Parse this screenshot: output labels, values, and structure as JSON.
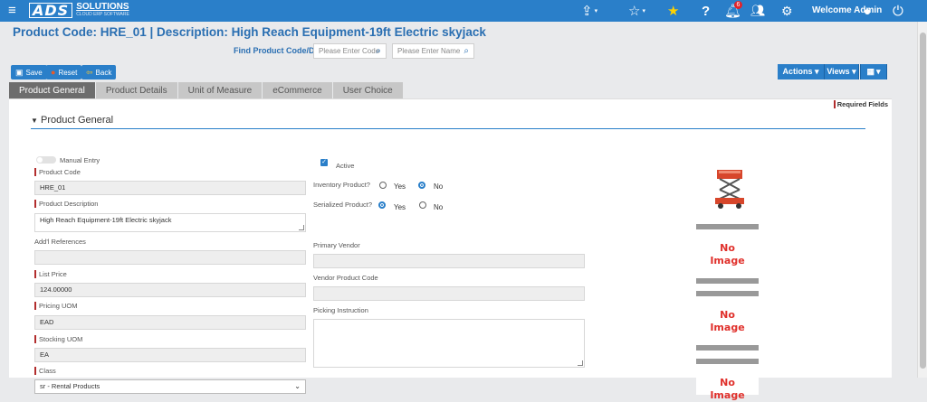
{
  "app": {
    "logo_main": "ADS",
    "logo_sub1": "SOLUTIONS",
    "logo_sub2": "CLOUD ERP SOFTWARE",
    "welcome": "Welcome Admin",
    "notification_count": "6"
  },
  "header": {
    "title": "Product Code:  HRE_01 | Description: High Reach Equipment-19ft Electric skyjack",
    "find_label": "Find Product Code/Desc",
    "code_placeholder": "Please Enter Code",
    "name_placeholder": "Please Enter Name"
  },
  "toolbar": {
    "save": "Save",
    "reset": "Reset",
    "back": "Back",
    "actions": "Actions ▾",
    "views": "Views ▾",
    "grid": "▾"
  },
  "tabs": [
    "Product General",
    "Product Details",
    "Unit of Measure",
    "eCommerce",
    "User Choice"
  ],
  "form": {
    "required_note": "Required Fields",
    "section_title": "Product General",
    "manual_entry": "Manual Entry",
    "product_code_label": "Product Code",
    "product_code": "HRE_01",
    "product_desc_label": "Product Description",
    "product_desc": "High Reach Equipment-19ft Electric skyjack",
    "add_refs_label": "Add'l References",
    "add_refs": "",
    "list_price_label": "List Price",
    "list_price": "124.00000",
    "pricing_uom_label": "Pricing UOM",
    "pricing_uom": "EAD",
    "stocking_uom_label": "Stocking UOM",
    "stocking_uom": "EA",
    "class_label": "Class",
    "class_value": "sr - Rental Products",
    "active_label": "Active",
    "inventory_label": "Inventory Product?",
    "serialized_label": "Serialized Product?",
    "yes": "Yes",
    "no": "No",
    "primary_vendor_label": "Primary Vendor",
    "vendor_code_label": "Vendor Product Code",
    "picking_label": "Picking Instruction"
  },
  "images": {
    "no_image_line1": "No",
    "no_image_line2": "Image"
  }
}
